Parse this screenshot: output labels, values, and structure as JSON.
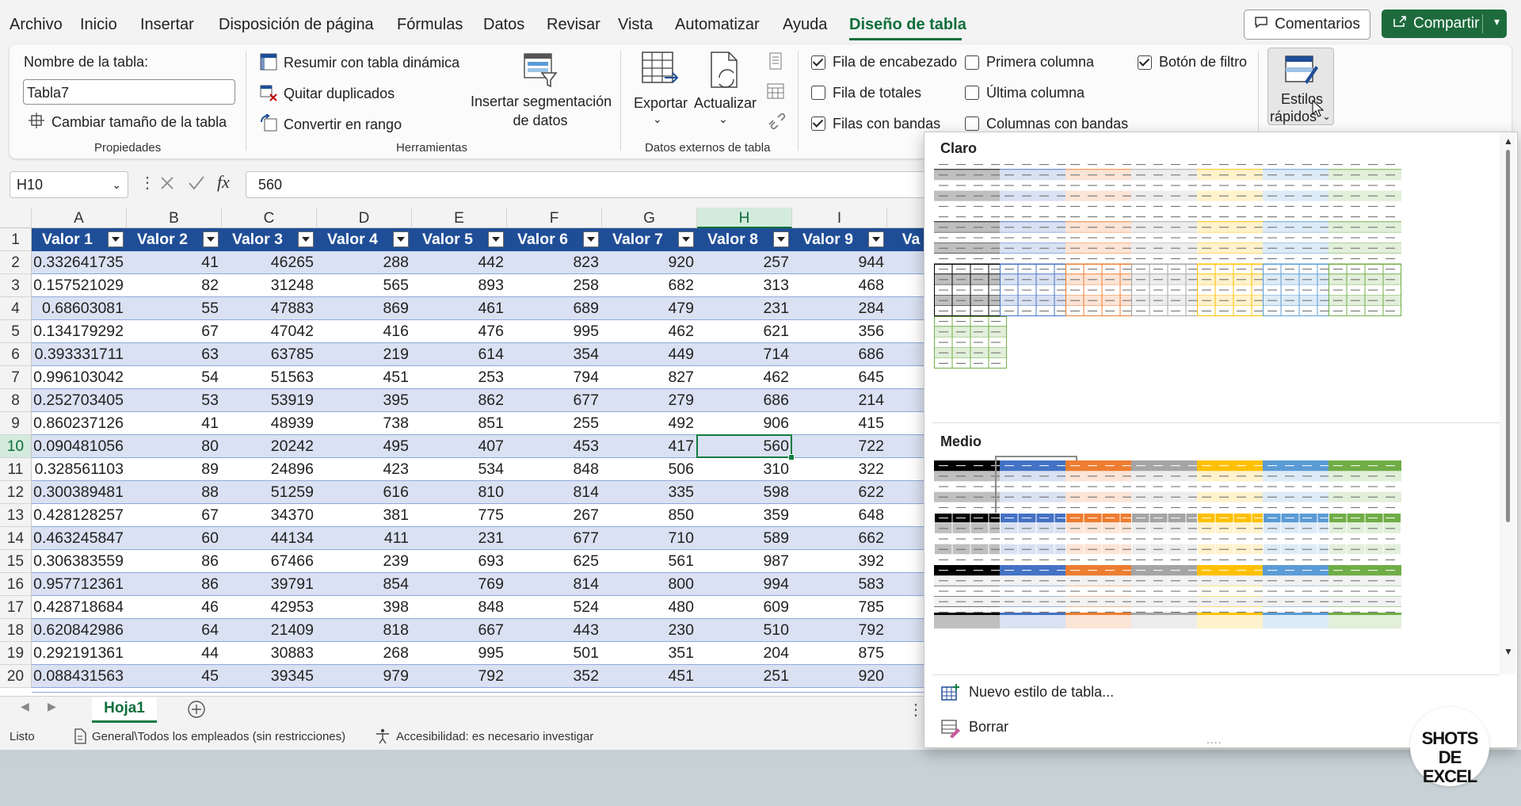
{
  "menu": {
    "tabs": [
      "Archivo",
      "Inicio",
      "Insertar",
      "Disposición de página",
      "Fórmulas",
      "Datos",
      "Revisar",
      "Vista",
      "Automatizar",
      "Ayuda",
      "Diseño de tabla"
    ],
    "comments_label": "Comentarios",
    "share_label": "Compartir"
  },
  "ribbon": {
    "properties": {
      "name_label": "Nombre de la tabla:",
      "name_value": "Tabla7",
      "resize_label": "Cambiar tamaño de la tabla",
      "group_label": "Propiedades"
    },
    "tools": {
      "pivot_label": "Resumir con tabla dinámica",
      "remove_dupes_label": "Quitar duplicados",
      "convert_label": "Convertir en rango",
      "slicer_line1": "Insertar segmentación",
      "slicer_line2": "de datos",
      "group_label": "Herramientas"
    },
    "external": {
      "export_label": "Exportar",
      "refresh_label": "Actualizar",
      "group_label": "Datos externos de tabla"
    },
    "style_options": {
      "header_row": "Fila de encabezado",
      "total_row": "Fila de totales",
      "banded_rows": "Filas con bandas",
      "first_column": "Primera columna",
      "last_column": "Última columna",
      "banded_columns": "Columnas con bandas",
      "filter_button": "Botón de filtro"
    },
    "quick_styles": {
      "line1": "Estilos",
      "line2": "rápidos"
    }
  },
  "formula_bar": {
    "cell_ref": "H10",
    "value": "560",
    "fx": "fx"
  },
  "grid": {
    "columns": [
      "A",
      "B",
      "C",
      "D",
      "E",
      "F",
      "G",
      "H",
      "I"
    ],
    "selected_column": "H",
    "selected_row": "10",
    "headers": [
      "Valor 1",
      "Valor 2",
      "Valor 3",
      "Valor 4",
      "Valor 5",
      "Valor 6",
      "Valor 7",
      "Valor 8",
      "Valor 9",
      "Va"
    ],
    "row_numbers": [
      "1",
      "2",
      "3",
      "4",
      "5",
      "6",
      "7",
      "8",
      "9",
      "10",
      "11",
      "12",
      "13",
      "14",
      "15",
      "16",
      "17",
      "18",
      "19",
      "20"
    ],
    "rows": [
      [
        "0.332641735",
        "41",
        "46265",
        "288",
        "442",
        "823",
        "920",
        "257",
        "944"
      ],
      [
        "0.157521029",
        "82",
        "31248",
        "565",
        "893",
        "258",
        "682",
        "313",
        "468"
      ],
      [
        "0.68603081",
        "55",
        "47883",
        "869",
        "461",
        "689",
        "479",
        "231",
        "284"
      ],
      [
        "0.134179292",
        "67",
        "47042",
        "416",
        "476",
        "995",
        "462",
        "621",
        "356"
      ],
      [
        "0.393331711",
        "63",
        "63785",
        "219",
        "614",
        "354",
        "449",
        "714",
        "686"
      ],
      [
        "0.996103042",
        "54",
        "51563",
        "451",
        "253",
        "794",
        "827",
        "462",
        "645"
      ],
      [
        "0.252703405",
        "53",
        "53919",
        "395",
        "862",
        "677",
        "279",
        "686",
        "214"
      ],
      [
        "0.860237126",
        "41",
        "48939",
        "738",
        "851",
        "255",
        "492",
        "906",
        "415"
      ],
      [
        "0.090481056",
        "80",
        "20242",
        "495",
        "407",
        "453",
        "417",
        "560",
        "722"
      ],
      [
        "0.328561103",
        "89",
        "24896",
        "423",
        "534",
        "848",
        "506",
        "310",
        "322"
      ],
      [
        "0.300389481",
        "88",
        "51259",
        "616",
        "810",
        "814",
        "335",
        "598",
        "622"
      ],
      [
        "0.428128257",
        "67",
        "34370",
        "381",
        "775",
        "267",
        "850",
        "359",
        "648"
      ],
      [
        "0.463245847",
        "60",
        "44134",
        "411",
        "231",
        "677",
        "710",
        "589",
        "662"
      ],
      [
        "0.306383559",
        "86",
        "67466",
        "239",
        "693",
        "625",
        "561",
        "987",
        "392"
      ],
      [
        "0.957712361",
        "86",
        "39791",
        "854",
        "769",
        "814",
        "800",
        "994",
        "583"
      ],
      [
        "0.428718684",
        "46",
        "42953",
        "398",
        "848",
        "524",
        "480",
        "609",
        "785"
      ],
      [
        "0.620842986",
        "64",
        "21409",
        "818",
        "667",
        "443",
        "230",
        "510",
        "792"
      ],
      [
        "0.292191361",
        "44",
        "30883",
        "268",
        "995",
        "501",
        "351",
        "204",
        "875"
      ],
      [
        "0.088431563",
        "45",
        "39345",
        "979",
        "792",
        "352",
        "451",
        "251",
        "920"
      ]
    ]
  },
  "sheet": {
    "tab_name": "Hoja1"
  },
  "status": {
    "ready": "Listo",
    "sensitivity": "General\\Todos los empleados (sin restricciones)",
    "accessibility": "Accesibilidad: es necesario investigar"
  },
  "gallery": {
    "light_title": "Claro",
    "medium_title": "Medio",
    "new_style_label": "Nuevo estilo de tabla...",
    "clear_label": "Borrar",
    "theme_colors": [
      "#000000",
      "#4472c4",
      "#ed7d31",
      "#a5a5a5",
      "#ffc000",
      "#5b9bd5",
      "#70ad47"
    ],
    "theme_tints": [
      "#bfbfbf",
      "#d9e1f2",
      "#fce4d6",
      "#ededed",
      "#fff2cc",
      "#ddebf7",
      "#e2efda"
    ]
  },
  "watermark": {
    "line1": "SHOTS",
    "line2": "DE EXCEL"
  }
}
